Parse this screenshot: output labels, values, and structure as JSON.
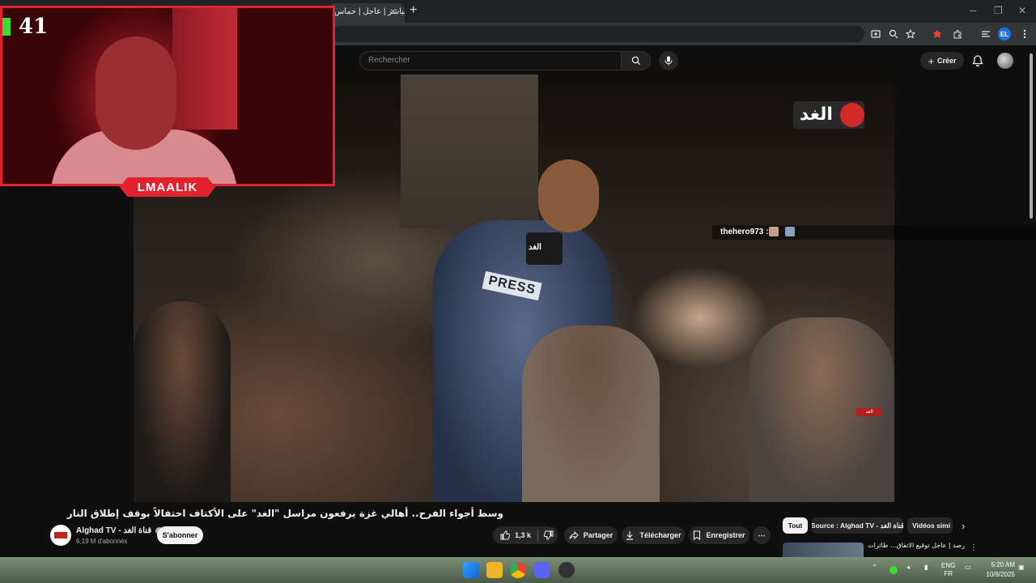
{
  "browser": {
    "tab_title": "مباشر | عاجل | حماس",
    "tab_close": "×",
    "new_tab": "+",
    "window_controls": [
      "─",
      "❐",
      "✕"
    ],
    "profile_initials": "EL"
  },
  "youtube": {
    "search_placeholder": "Rechercher",
    "create_label": "Créer",
    "create_icon": "+"
  },
  "overlay": {
    "viewer_count": "41",
    "streamer_name": "LMAALIK",
    "chat_user": "thehero973 :",
    "chat_emote_colors": [
      "#c7a088",
      "#8aa0c0"
    ]
  },
  "video": {
    "watermark_logo_text": "الغد",
    "press_text": "PRESS",
    "mic_label": "الغد",
    "corner_logo_text": "الغد"
  },
  "watch": {
    "title": "وسط أجواء الفرح.. أهالي غزة يرفعون مراسل \"الغد\" على الأكتاف احتفالاً بوقف إطلاق النار",
    "channel_name": "Alghad TV - قناة الغد",
    "subscribers": "6,19 M d'abonnés",
    "subscribe_label": "S'abonner",
    "likes": "1,3 k",
    "share_label": "Partager",
    "download_label": "Télécharger",
    "save_label": "Enregistrer",
    "more_label": "⋯"
  },
  "sidebar": {
    "chips": [
      {
        "label": "Tout",
        "active": true
      },
      {
        "label": "Source : Alghad TV - قناة الغد",
        "active": false
      },
      {
        "label": "Vidéos simi",
        "active": false
      }
    ],
    "chips_next": "›",
    "reco_title": "رصد | عاجل توقيع الاتفاق... طائرات الاحتلال",
    "reco_more": "⋮"
  },
  "taskbar": {
    "lang_top": "ENG",
    "lang_bottom": "FR",
    "time": "5:20 AM",
    "date": "10/9/2025"
  },
  "colors": {
    "accent_red": "#e2232f",
    "youtube_bg": "#0f0f0f",
    "pill_bg": "#272727"
  }
}
